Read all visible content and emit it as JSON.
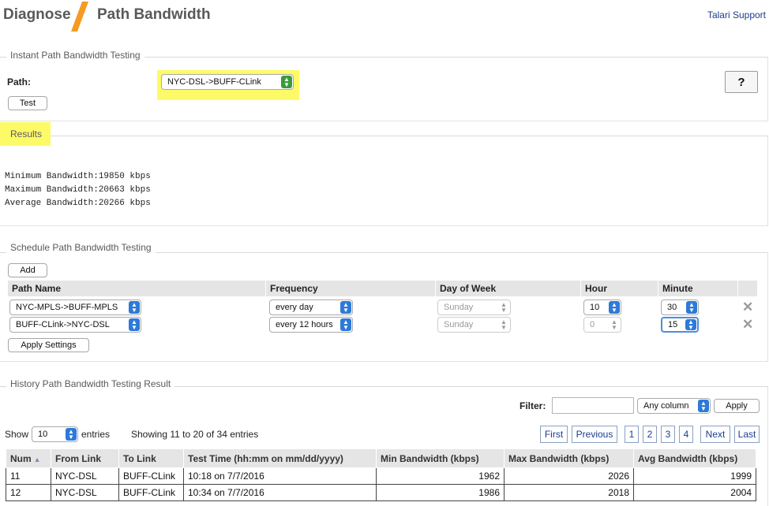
{
  "header": {
    "section": "Diagnose",
    "page": "Path Bandwidth",
    "support_link": "Talari Support",
    "accent_color": "#f59a23"
  },
  "instant": {
    "legend": "Instant Path Bandwidth Testing",
    "path_label": "Path:",
    "path_value": "NYC-DSL->BUFF-CLink",
    "test_button": "Test",
    "help_button": "?"
  },
  "results": {
    "legend": "Results",
    "lines": [
      "Minimum Bandwidth:19850 kbps",
      "Maximum Bandwidth:20663 kbps",
      "Average Bandwidth:20266 kbps"
    ]
  },
  "schedule": {
    "legend": "Schedule Path Bandwidth Testing",
    "add_button": "Add",
    "apply_button": "Apply Settings",
    "columns": [
      "Path Name",
      "Frequency",
      "Day of Week",
      "Hour",
      "Minute"
    ],
    "rows": [
      {
        "path": "NYC-MPLS->BUFF-MPLS",
        "frequency": "every day",
        "day": "Sunday",
        "hour": "10",
        "minute": "30"
      },
      {
        "path": "BUFF-CLink->NYC-DSL",
        "frequency": "every 12 hours",
        "day": "Sunday",
        "hour": "0",
        "minute": "15"
      }
    ]
  },
  "history": {
    "legend": "History Path Bandwidth Testing Result",
    "filter_label": "Filter:",
    "filter_value": "",
    "filter_column": "Any column",
    "filter_apply": "Apply",
    "show_label": "Show",
    "show_value": "10",
    "entries_label": "entries",
    "showing": "Showing 11 to 20 of 34 entries",
    "pagination": {
      "first": "First",
      "previous": "Previous",
      "pages": [
        "1",
        "2",
        "3",
        "4"
      ],
      "current_page": "2",
      "next": "Next",
      "last": "Last"
    },
    "columns": [
      "Num",
      "From Link",
      "To Link",
      "Test Time (hh:mm on mm/dd/yyyy)",
      "Min Bandwidth (kbps)",
      "Max Bandwidth (kbps)",
      "Avg Bandwidth (kbps)"
    ],
    "rows": [
      {
        "num": "11",
        "from": "NYC-DSL",
        "to": "BUFF-CLink",
        "time": "10:18 on 7/7/2016",
        "min": "1962",
        "max": "2026",
        "avg": "1999"
      },
      {
        "num": "12",
        "from": "NYC-DSL",
        "to": "BUFF-CLink",
        "time": "10:34 on 7/7/2016",
        "min": "1986",
        "max": "2018",
        "avg": "2004"
      }
    ]
  }
}
